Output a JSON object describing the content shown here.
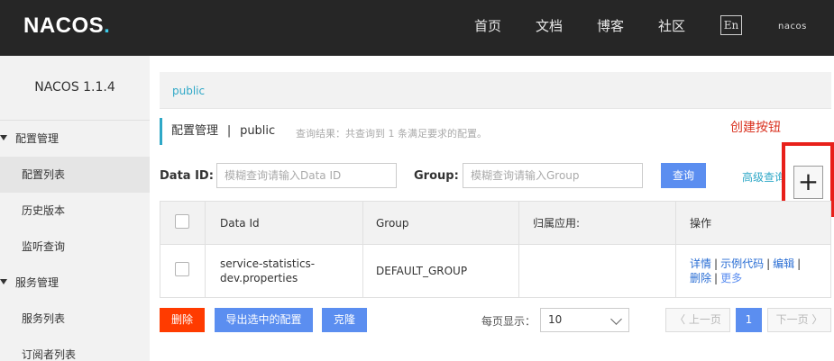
{
  "header": {
    "logo_text": "NACOS",
    "logo_dot": ".",
    "nav": [
      "首页",
      "文档",
      "博客",
      "社区"
    ],
    "lang_button": "En",
    "user": "nacos"
  },
  "sidebar": {
    "version": "NACOS 1.1.4",
    "groups": [
      {
        "title": "配置管理",
        "items": [
          "配置列表",
          "历史版本",
          "监听查询"
        ]
      },
      {
        "title": "服务管理",
        "items": [
          "服务列表",
          "订阅者列表"
        ]
      }
    ]
  },
  "breadcrumb": "public",
  "title": {
    "main": "配置管理",
    "separator": "|",
    "namespace": "public",
    "query_result": "查询结果：共查询到 1 条满足要求的配置。"
  },
  "annotation": {
    "label": "创建按钮",
    "color": "#e8201a"
  },
  "search": {
    "data_id_label": "Data ID:",
    "data_id_placeholder": "模糊查询请输入Data ID",
    "group_label": "Group:",
    "group_placeholder": "模糊查询请输入Group",
    "query_button": "查询",
    "advanced_link": "高级查询",
    "create_button": "+"
  },
  "table": {
    "columns": [
      "Data Id",
      "Group",
      "归属应用:",
      "操作"
    ],
    "rows": [
      {
        "data_id_line1": "service-statistics-",
        "data_id_line2": "dev.properties",
        "group": "DEFAULT_GROUP",
        "app": "",
        "ops_line1": [
          "详情",
          "示例代码",
          "编辑"
        ],
        "ops_line2": [
          "删除",
          "更多"
        ]
      }
    ]
  },
  "actions": {
    "delete_button": "删除",
    "export_button": "导出选中的配置",
    "clone_button": "克隆"
  },
  "pagination": {
    "per_page_label": "每页显示：",
    "per_page_value": "10",
    "prev_label": "〈 上一页",
    "current_page": "1",
    "next_label": "下一页 〉"
  },
  "colors": {
    "header_bg": "#262626",
    "accent": "#2fa8c7",
    "primary_button": "#5b8ef0",
    "danger_button": "#ff3b00"
  }
}
